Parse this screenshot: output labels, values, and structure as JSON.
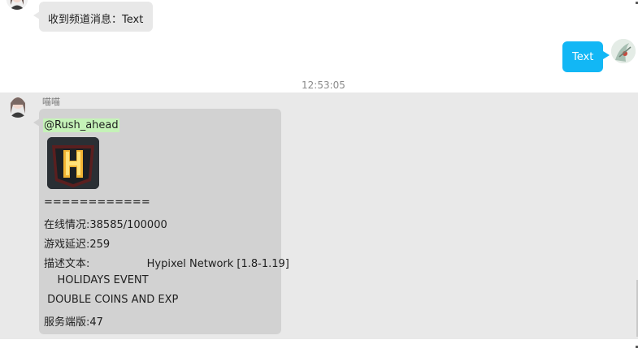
{
  "messages": {
    "incoming_1": {
      "text": "收到频道消息：Text"
    },
    "outgoing_1": {
      "text": "Text"
    },
    "timestamp": "12:53:05",
    "incoming_2": {
      "sender": "喵喵",
      "mention": "@Rush_ahead",
      "server_icon": "hypixel-logo-icon",
      "lines": [
        "============",
        "在线情况:38585/100000",
        "游戏延迟:259",
        "描述文本:                 Hypixel Network [1.8-1.19]",
        "    HOLIDAYS EVENT",
        " DOUBLE COINS AND EXP",
        "服务端版:47"
      ]
    }
  },
  "colors": {
    "incoming_bubble": "#e8e8e8",
    "outgoing_bubble": "#12b7f5",
    "band": "#e9e9e9",
    "card": "#d2d2d2",
    "mention_highlight": "#c5f2b8"
  }
}
